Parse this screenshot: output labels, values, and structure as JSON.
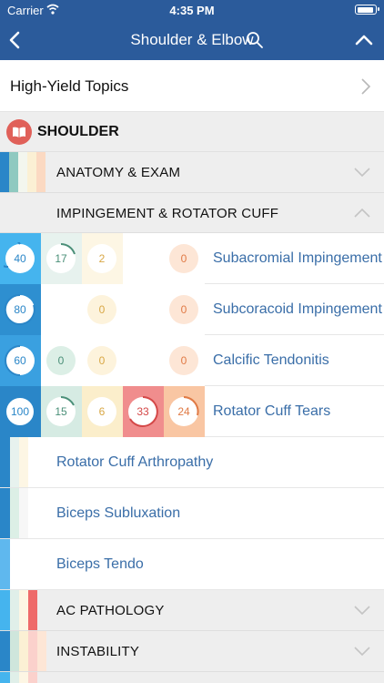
{
  "status": {
    "carrier": "Carrier",
    "time": "4:35 PM"
  },
  "nav": {
    "title": "Shoulder & Elbow"
  },
  "high_yield": {
    "label": "High-Yield Topics"
  },
  "section": {
    "label": "SHOULDER"
  },
  "groups": {
    "anatomy": "ANATOMY & EXAM",
    "impingement": "IMPINGEMENT & ROTATOR CUFF",
    "ac": "AC PATHOLOGY",
    "instability": "INSTABILITY"
  },
  "topics": [
    {
      "label": "Subacromial Impingement",
      "scores": [
        "40",
        "17",
        "2",
        "",
        "0"
      ]
    },
    {
      "label": "Subcoracoid Impingement",
      "scores": [
        "80",
        "",
        "0",
        "",
        "0"
      ]
    },
    {
      "label": "Calcific Tendonitis",
      "scores": [
        "60",
        "0",
        "0",
        "",
        "0"
      ]
    },
    {
      "label": "Rotator Cuff Tears",
      "scores": [
        "100",
        "15",
        "6",
        "33",
        "24"
      ]
    }
  ],
  "simple_topics": [
    {
      "label": "Rotator Cuff Arthropathy"
    },
    {
      "label": "Biceps Subluxation"
    },
    {
      "label": "Biceps Tendo"
    }
  ],
  "colors": {
    "nav": "#2b5b9b",
    "blue": "#3aa0e0",
    "green": "#cfe6dc",
    "yellow": "#fbf0d4",
    "red": "#f08d8d",
    "orange": "#fbd9c2",
    "link": "#3a6ea8"
  },
  "icons": [
    "wifi-icon",
    "battery-icon",
    "back-chevron-icon",
    "search-icon",
    "collapse-chevron-icon",
    "chevron-right-icon",
    "book-icon",
    "chevron-down-icon",
    "chevron-up-icon"
  ]
}
